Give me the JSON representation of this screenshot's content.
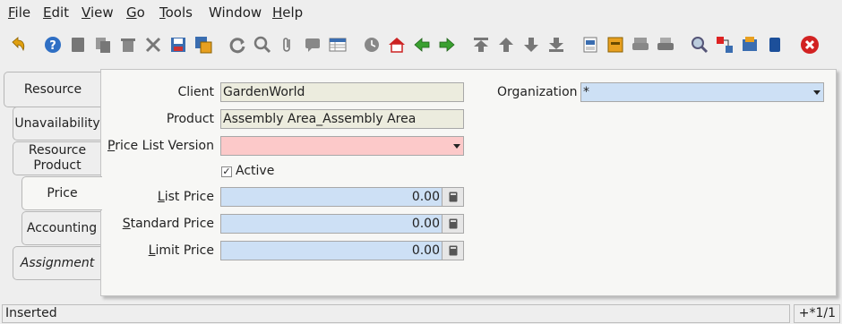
{
  "menu": {
    "file": "File",
    "edit": "Edit",
    "view": "View",
    "go": "Go",
    "tools": "Tools",
    "window": "Window",
    "help": "Help"
  },
  "toolbar_icons": [
    "undo-icon",
    "help-icon",
    "new-icon",
    "copy-icon",
    "delete-icon",
    "delete-selection-icon",
    "save-icon",
    "save-and-new-icon",
    "refresh-icon",
    "find-icon",
    "attachment-icon",
    "chat-icon",
    "grid-toggle-icon",
    "history-icon",
    "home-icon",
    "previous-icon",
    "next-icon",
    "first-record-icon",
    "parent-record-icon",
    "detail-record-icon",
    "last-record-icon",
    "report-icon",
    "archive-icon",
    "print-preview-icon",
    "print-icon",
    "zoom-across-icon",
    "request-icon",
    "product-info-icon",
    "workflow-icon",
    "exit-icon"
  ],
  "tabs": [
    {
      "label": "Resource"
    },
    {
      "label": "Unavailability"
    },
    {
      "label": "Resource Product"
    },
    {
      "label": "Price"
    },
    {
      "label": "Accounting"
    },
    {
      "label": "Assignment"
    }
  ],
  "form": {
    "client_label": "Client",
    "client_value": "GardenWorld",
    "org_label": "Organization",
    "org_value": "*",
    "product_label": "Product",
    "product_value": "Assembly Area_Assembly Area",
    "plv_label": "Price List Version",
    "plv_value": "",
    "active_label": "Active",
    "active_checked": true,
    "list_price_label": "List Price",
    "list_price_value": "0.00",
    "standard_price_label": "Standard Price",
    "standard_price_value": "0.00",
    "limit_price_label": "Limit Price",
    "limit_price_value": "0.00"
  },
  "status": {
    "message": "Inserted",
    "record_nav": "+*1/1"
  },
  "colors": {
    "readonly_field": "#ececde",
    "editable_field": "#cde0f5",
    "mandatory_field": "#fcc9c9",
    "exit_red": "#d22222"
  }
}
